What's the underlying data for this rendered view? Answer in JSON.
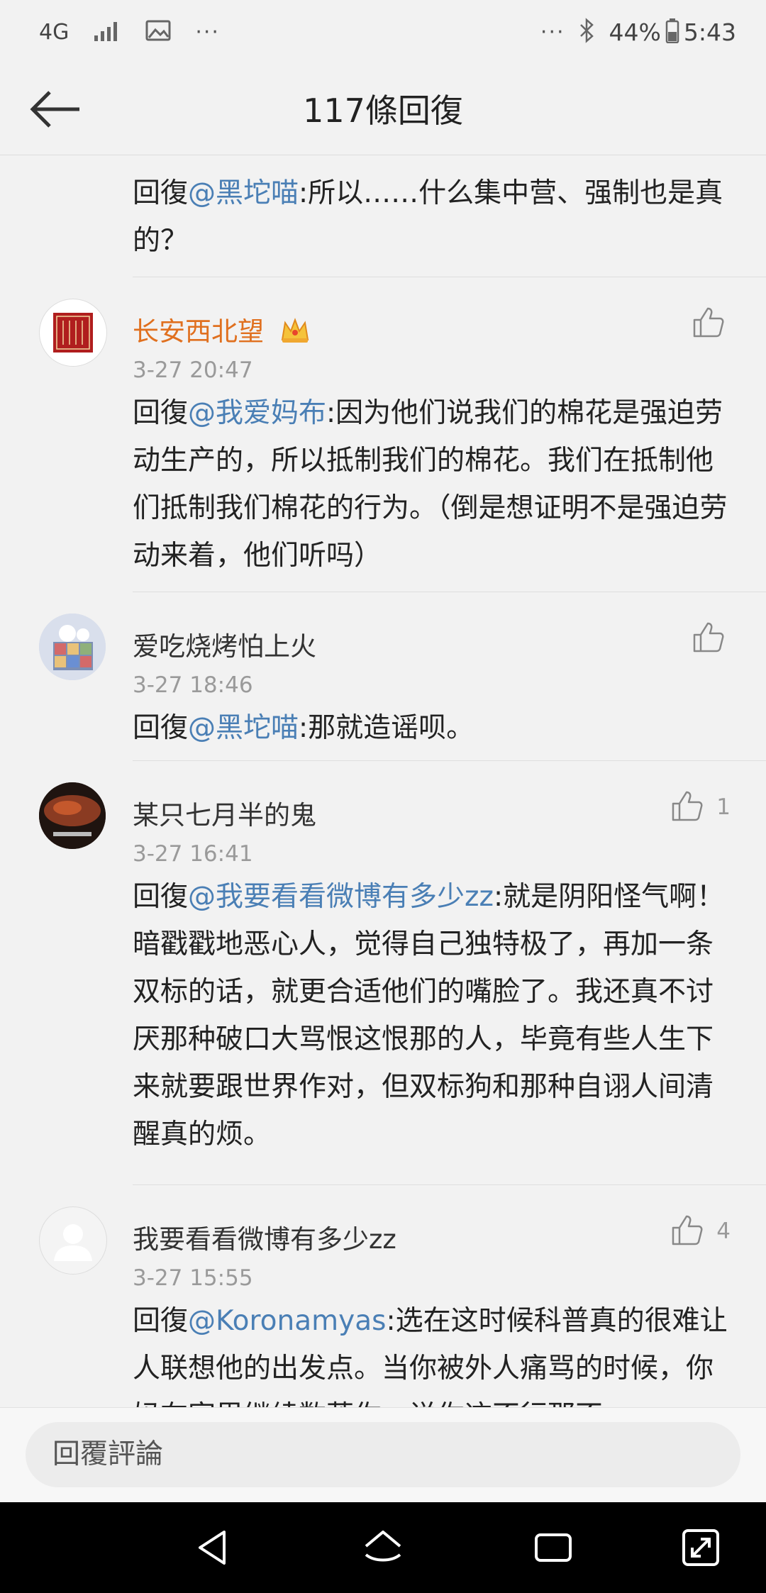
{
  "status_bar": {
    "network": "4G",
    "dots_left": "···",
    "dots_right": "···",
    "battery": "44%",
    "time": "5:43"
  },
  "header": {
    "title": "117條回復"
  },
  "comments": [
    {
      "partial": true,
      "reply_prefix": "回復",
      "mention": "@黑坨喵",
      "text": ":所以……什么集中营、强制也是真的？"
    },
    {
      "author": "长安西北望",
      "vip_icon": "crown-icon",
      "time": "3-27 20:47",
      "reply_prefix": "回復",
      "mention": "@我爱妈布",
      "text": ":因为他们说我们的棉花是强迫劳动生产的，所以抵制我们的棉花。我们在抵制他们抵制我们棉花的行为。（倒是想证明不是强迫劳动来着，他们听吗）",
      "likes": ""
    },
    {
      "author": "爱吃烧烤怕上火",
      "time": "3-27 18:46",
      "reply_prefix": "回復",
      "mention": "@黑坨喵",
      "text": ":那就造谣呗。",
      "likes": ""
    },
    {
      "author": "某只七月半的鬼",
      "time": "3-27 16:41",
      "reply_prefix": "回復",
      "mention": "@我要看看微博有多少zz",
      "text": ":就是阴阳怪气啊！暗戳戳地恶心人，觉得自己独特极了，再加一条双标的话，就更合适他们的嘴脸了。我还真不讨厌那种破口大骂恨这恨那的人，毕竟有些人生下来就要跟世界作对，但双标狗和那种自诩人间清醒真的烦。",
      "likes": "1"
    },
    {
      "author": "我要看看微博有多少zz",
      "time": "3-27 15:55",
      "reply_prefix": "回復",
      "mention": "@Koronamyas",
      "text": ":选在这时候科普真的很难让人联想他的出发点。当你被外人痛骂的时候，你妈在家里继续数落你，说你这不行那不",
      "likes": "4"
    }
  ],
  "input": {
    "placeholder": "回覆評論"
  },
  "colors": {
    "mention": "#4a7fb5",
    "vip_name": "#e0701f",
    "meta": "#9a9a9a"
  }
}
